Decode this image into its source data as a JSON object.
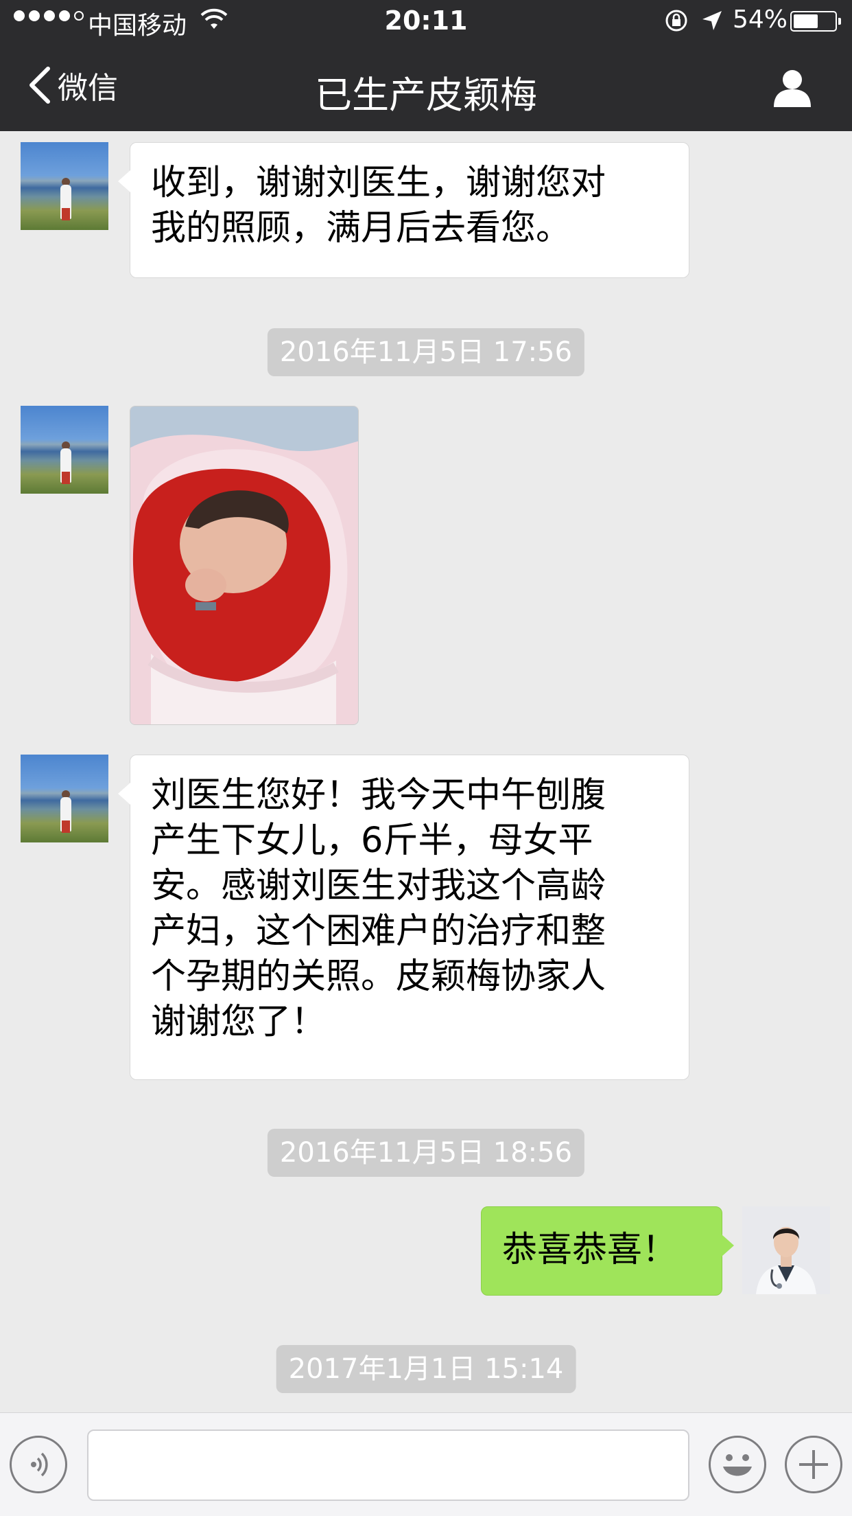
{
  "status_bar": {
    "carrier": "中国移动",
    "time": "20:11",
    "battery": "54%",
    "battery_level": 0.54
  },
  "nav": {
    "back_label": "微信",
    "title": "已生产皮颖梅"
  },
  "messages": [
    {
      "type": "text",
      "side": "left",
      "text": "收到，谢谢刘医生，谢谢您对\n我的照顾，满月后去看您。"
    },
    {
      "type": "timestamp",
      "text": "2016年11月5日 17:56"
    },
    {
      "type": "image",
      "side": "left"
    },
    {
      "type": "text",
      "side": "left",
      "text": "刘医生您好！我今天中午刨腹\n产生下女儿，6斤半，母女平\n安。感谢刘医生对我这个高龄\n产妇，这个困难户的治疗和整\n个孕期的关照。皮颖梅协家人\n谢谢您了！"
    },
    {
      "type": "timestamp",
      "text": "2016年11月5日 18:56"
    },
    {
      "type": "text",
      "side": "right",
      "text": "恭喜恭喜！"
    },
    {
      "type": "timestamp",
      "text": "2017年1月1日 15:14"
    }
  ],
  "colors": {
    "header_bg": "#2c2c2e",
    "chat_bg": "#ebebeb",
    "sent_bubble": "#9fe45a",
    "received_bubble": "#ffffff",
    "timestamp_bg": "#cecece"
  }
}
